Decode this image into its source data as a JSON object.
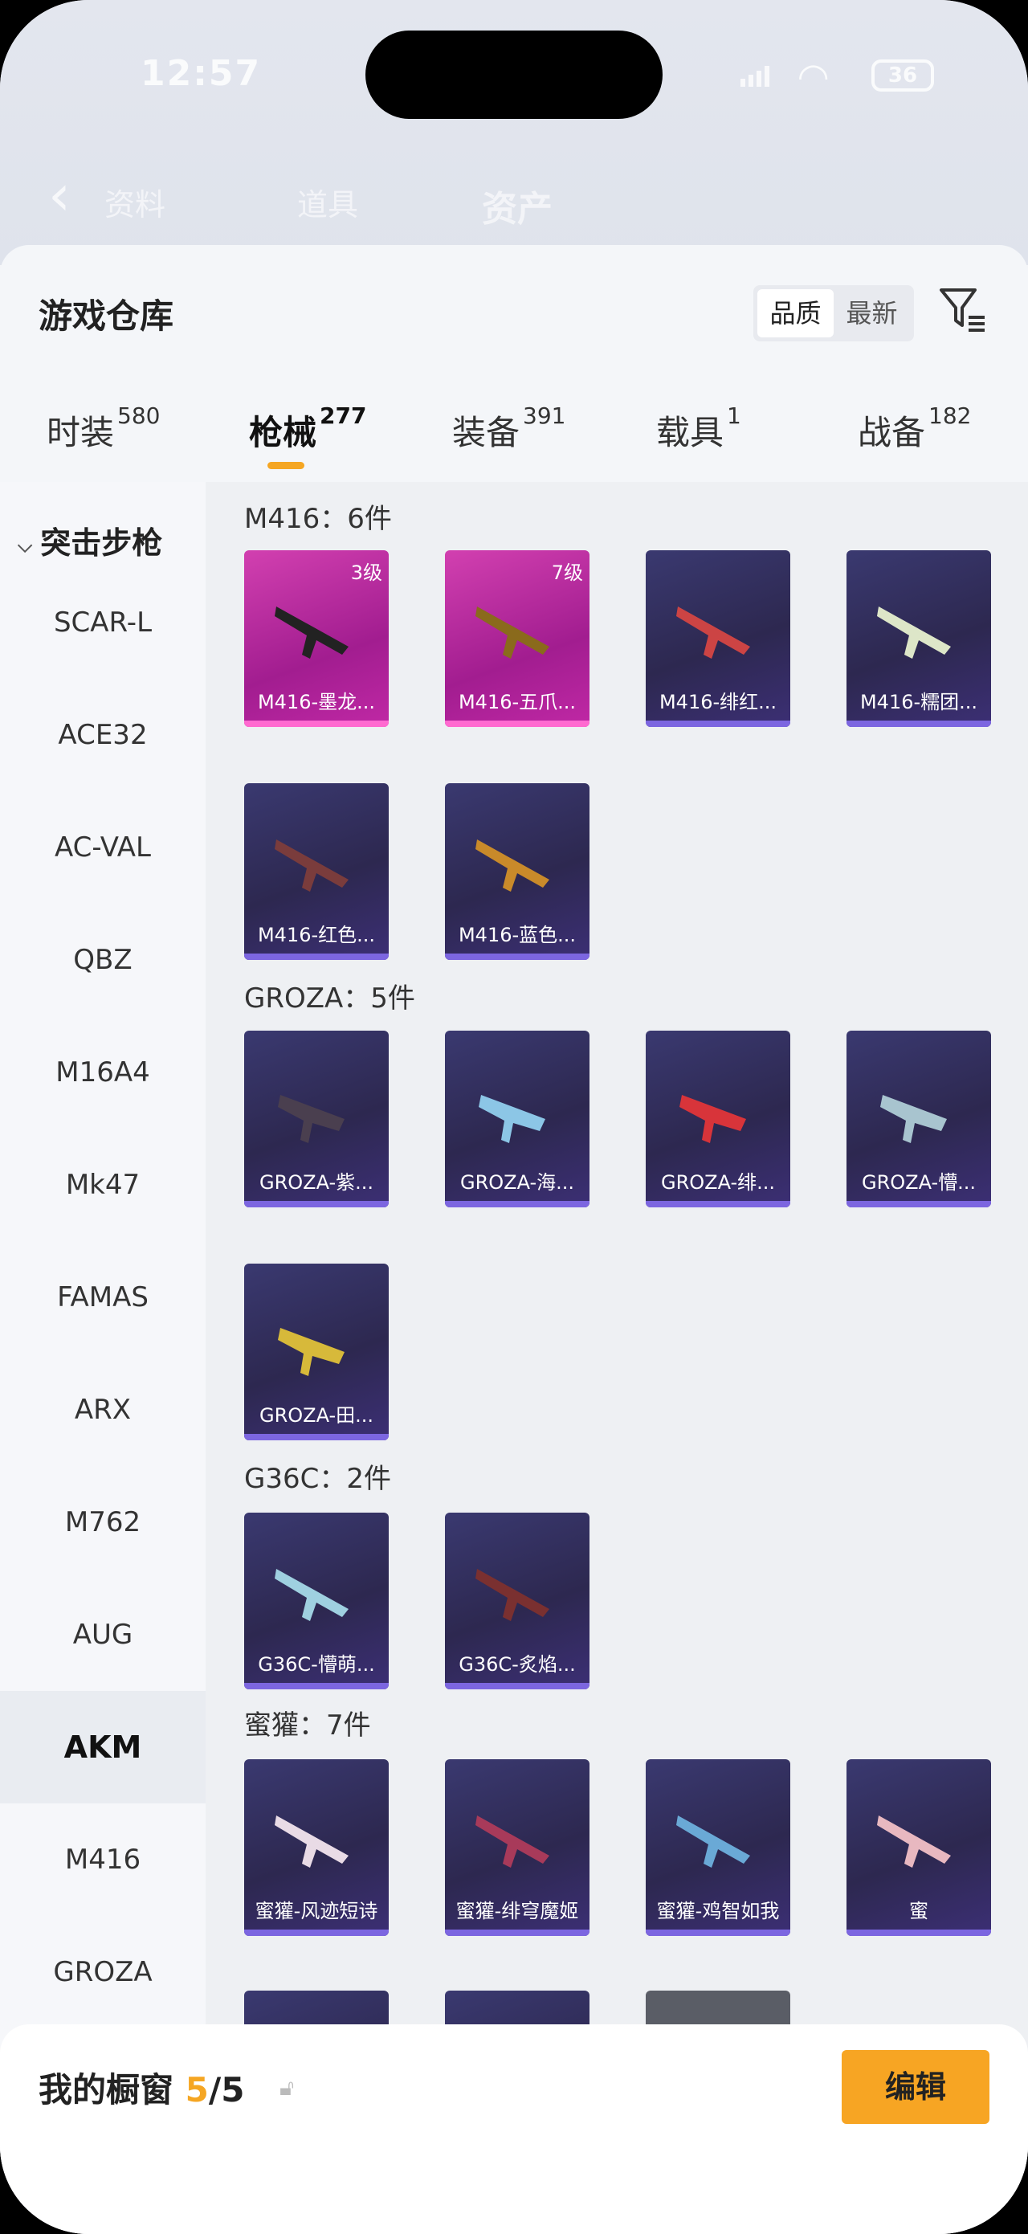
{
  "status": {
    "time": "12:57",
    "battery": "36"
  },
  "bg_nav": {
    "back_label": "‹",
    "tabs": [
      "资料",
      "道具",
      "资产"
    ]
  },
  "sheet": {
    "title": "游戏仓库",
    "sort": {
      "options": [
        "品质",
        "最新"
      ],
      "selected": "品质"
    },
    "filter_icon": "filter-icon"
  },
  "tabs": [
    {
      "label": "时装",
      "count": "580"
    },
    {
      "label": "枪械",
      "count": "277",
      "active": true
    },
    {
      "label": "装备",
      "count": "391"
    },
    {
      "label": "载具",
      "count": "1"
    },
    {
      "label": "战备",
      "count": "182"
    }
  ],
  "sidebar": {
    "category": "突击步枪",
    "items": [
      "SCAR-L",
      "ACE32",
      "AC-VAL",
      "QBZ",
      "M16A4",
      "Mk47",
      "FAMAS",
      "ARX",
      "M762",
      "AUG",
      "AKM",
      "M416",
      "GROZA"
    ],
    "selected": "AKM"
  },
  "sections": [
    {
      "title": "M416：6件",
      "items": [
        {
          "name": "M416-墨龙...",
          "level": "3级",
          "pink": true
        },
        {
          "name": "M416-五爪...",
          "level": "7级",
          "pink": true
        },
        {
          "name": "M416-绯红..."
        },
        {
          "name": "M416-糯团..."
        },
        {
          "name": "M416-红色..."
        },
        {
          "name": "M416-蓝色..."
        }
      ]
    },
    {
      "title": "GROZA：5件",
      "items": [
        {
          "name": "GROZA-紫..."
        },
        {
          "name": "GROZA-海..."
        },
        {
          "name": "GROZA-绯..."
        },
        {
          "name": "GROZA-懵..."
        },
        {
          "name": "GROZA-田..."
        }
      ]
    },
    {
      "title": "G36C：2件",
      "items": [
        {
          "name": "G36C-懵萌..."
        },
        {
          "name": "G36C-炙焰..."
        }
      ]
    },
    {
      "title": "蜜獾：7件",
      "items": [
        {
          "name": "蜜獾-风迹短诗"
        },
        {
          "name": "蜜獾-绯穹魔姬"
        },
        {
          "name": "蜜獾-鸡智如我"
        },
        {
          "name": "蜜"
        }
      ]
    }
  ],
  "bottom": {
    "label": "我的橱窗 ",
    "current": "5",
    "total": "/5",
    "edit": "编辑"
  }
}
